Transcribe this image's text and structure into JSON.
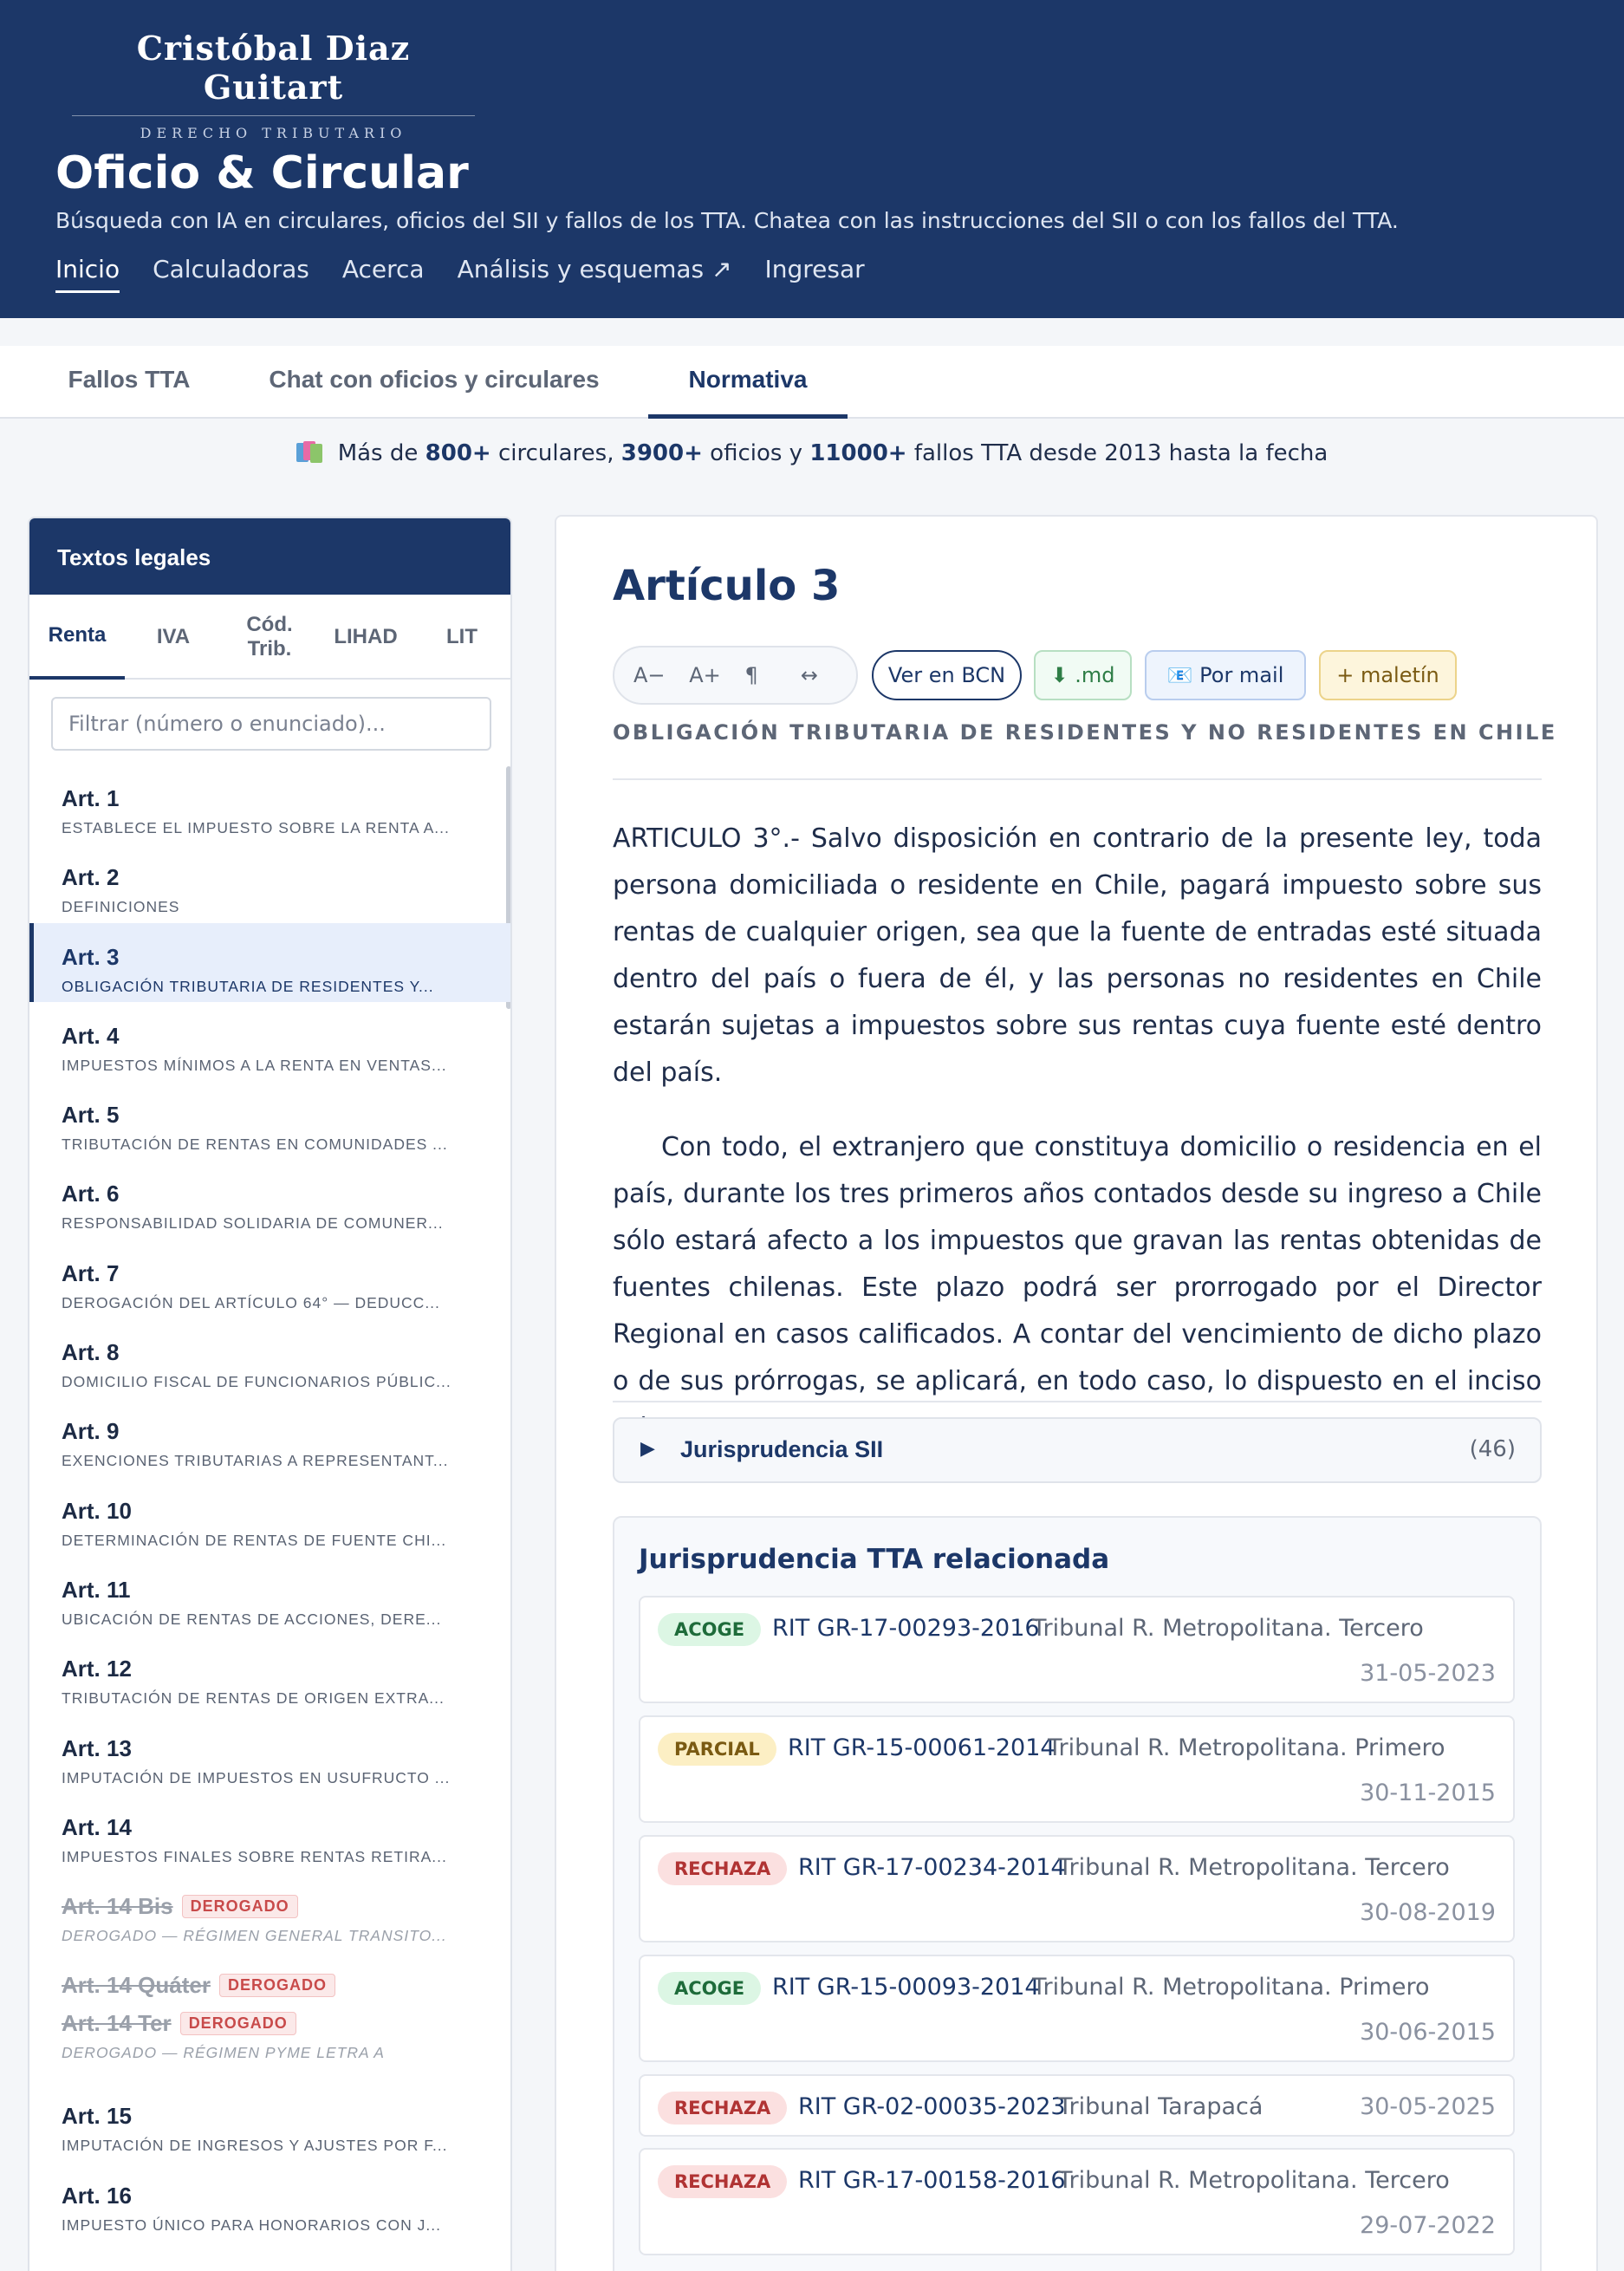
{
  "brand": {
    "name": "Cristóbal Diaz Guitart",
    "subtitle": "DERECHO TRIBUTARIO"
  },
  "site": {
    "title": "Oficio & Circular",
    "description": "Búsqueda con IA en circulares, oficios del SII y fallos de los TTA. Chatea con las instrucciones del SII o con los fallos del TTA."
  },
  "nav": [
    "Inicio",
    "Calculadoras",
    "Acerca",
    "Análisis y esquemas ↗",
    "Ingresar"
  ],
  "tabs": [
    "Fallos TTA",
    "Chat con oficios y circulares",
    "Normativa"
  ],
  "stats": {
    "pre": "Más de ",
    "circ": "800+",
    "circ_label": " circulares, ",
    "ofi": "3900+",
    "ofi_label": " oficios y ",
    "fallos": "11000+",
    "fallos_label": " fallos TTA desde 2013 hasta la fecha"
  },
  "sidebar": {
    "title": "Textos legales",
    "tabs": [
      "Renta",
      "IVA",
      "Cód.\nTrib.",
      "LIHAD",
      "LIT"
    ],
    "filter_placeholder": "Filtrar (número o enunciado)...",
    "derogado_label": "DEROGADO",
    "articles": [
      {
        "num": "Art. 1",
        "desc": "ESTABLECE EL IMPUESTO SOBRE LA RENTA A...",
        "derog": false
      },
      {
        "num": "Art. 2",
        "desc": "DEFINICIONES",
        "derog": false
      },
      {
        "num": "Art. 3",
        "desc": "OBLIGACIÓN TRIBUTARIA DE RESIDENTES Y...",
        "derog": false,
        "active": true
      },
      {
        "num": "Art. 4",
        "desc": "IMPUESTOS MÍNIMOS A LA RENTA EN VENTAS...",
        "derog": false
      },
      {
        "num": "Art. 5",
        "desc": "TRIBUTACIÓN DE RENTAS EN COMUNIDADES ...",
        "derog": false
      },
      {
        "num": "Art. 6",
        "desc": "RESPONSABILIDAD SOLIDARIA DE COMUNER...",
        "derog": false
      },
      {
        "num": "Art. 7",
        "desc": "DEROGACIÓN DEL ARTÍCULO 64° — DEDUCC...",
        "derog": false
      },
      {
        "num": "Art. 8",
        "desc": "DOMICILIO FISCAL DE FUNCIONARIOS PÚBLIC...",
        "derog": false
      },
      {
        "num": "Art. 9",
        "desc": "EXENCIONES TRIBUTARIAS A REPRESENTANT...",
        "derog": false
      },
      {
        "num": "Art. 10",
        "desc": "DETERMINACIÓN DE RENTAS DE FUENTE CHI...",
        "derog": false
      },
      {
        "num": "Art. 11",
        "desc": "UBICACIÓN DE RENTAS DE ACCIONES, DERE...",
        "derog": false
      },
      {
        "num": "Art. 12",
        "desc": "TRIBUTACIÓN DE RENTAS DE ORIGEN EXTRA...",
        "derog": false
      },
      {
        "num": "Art. 13",
        "desc": "IMPUTACIÓN DE IMPUESTOS EN USUFRUCTO ...",
        "derog": false
      },
      {
        "num": "Art. 14",
        "desc": "IMPUESTOS FINALES SOBRE RENTAS RETIRA...",
        "derog": false
      },
      {
        "num": "Art. 14 Bis",
        "desc": "DEROGADO — RÉGIMEN GENERAL TRANSITO...",
        "derog": true
      },
      {
        "num": "Art. 14 Quáter",
        "desc": "",
        "derog": true
      },
      {
        "num": "Art. 14 Ter",
        "desc": "DEROGADO — RÉGIMEN PYME LETRA A",
        "derog": true
      },
      {
        "num": "Art. 15",
        "desc": "IMPUTACIÓN DE INGRESOS Y AJUSTES POR F...",
        "derog": false
      },
      {
        "num": "Art. 16",
        "desc": "IMPUESTO ÚNICO PARA HONORARIOS CON J...",
        "derog": false
      }
    ]
  },
  "article": {
    "title": "Artículo 3",
    "tools": [
      "A−",
      "A+",
      "¶",
      "↔"
    ],
    "buttons": {
      "bcn": "Ver en BCN",
      "md": "⬇ .md",
      "mail": "📧 Por mail",
      "maletin": "+ maletín"
    },
    "subtitle": "OBLIGACIÓN TRIBUTARIA DE RESIDENTES Y NO RESIDENTES EN CHILE",
    "paragraphs": [
      "ARTICULO 3°.- Salvo disposición en contrario de la presente ley, toda persona domiciliada o residente en Chile, pagará impuesto sobre sus rentas de cualquier origen, sea que la fuente de entradas esté situada dentro del país o fuera de él, y las personas no residentes en Chile estarán sujetas a impuestos sobre sus rentas cuya fuente esté dentro del país.",
      "Con todo, el extranjero que constituya domicilio o residencia en el país, durante los tres primeros años contados desde su ingreso a Chile sólo estará afecto a los impuestos que gravan las rentas obtenidas de fuentes chilenas. Este plazo podrá ser prorrogado por el Director Regional en casos calificados. A contar del vencimiento de dicho plazo o de sus prórrogas, se aplicará, en todo caso, lo dispuesto en el inciso primero."
    ]
  },
  "jurisprudencia_sii": {
    "label": "Jurisprudencia SII",
    "count": "(46)"
  },
  "tta": {
    "title": "Jurisprudencia TTA relacionada",
    "cases": [
      {
        "badge": "ACOGE",
        "rit": "RIT GR-17-00293-2016",
        "tribunal": "Tribunal R. Metropolitana. Tercero",
        "date": "31-05-2023"
      },
      {
        "badge": "PARCIAL",
        "rit": "RIT GR-15-00061-2014",
        "tribunal": "Tribunal R. Metropolitana. Primero",
        "date": "30-11-2015"
      },
      {
        "badge": "RECHAZA",
        "rit": "RIT GR-17-00234-2014",
        "tribunal": "Tribunal R. Metropolitana. Tercero",
        "date": "30-08-2019"
      },
      {
        "badge": "ACOGE",
        "rit": "RIT GR-15-00093-2014",
        "tribunal": "Tribunal R. Metropolitana. Primero",
        "date": "30-06-2015"
      },
      {
        "badge": "RECHAZA",
        "rit": "RIT GR-02-00035-2023",
        "tribunal": "Tribunal Tarapacá",
        "date": "30-05-2025"
      },
      {
        "badge": "RECHAZA",
        "rit": "RIT GR-17-00158-2016",
        "tribunal": "Tribunal R. Metropolitana. Tercero",
        "date": "29-07-2022"
      }
    ]
  }
}
